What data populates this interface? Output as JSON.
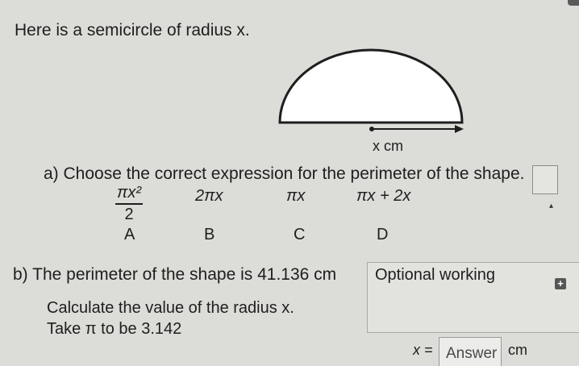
{
  "question": {
    "intro": "Here is a semicircle of radius x.",
    "diagram_label": "x cm"
  },
  "part_a": {
    "prompt": "a) Choose the correct expression for the perimeter of the shape.",
    "options": [
      {
        "numerator": "πx²",
        "denominator": "2",
        "letter": "A"
      },
      {
        "expression": "2πx",
        "letter": "B"
      },
      {
        "expression": "πx",
        "letter": "C"
      },
      {
        "expression": "πx + 2x",
        "letter": "D"
      }
    ]
  },
  "part_b": {
    "statement": "b) The perimeter of the shape is 41.136 cm",
    "instruction": "Calculate the value of the radius x.",
    "pi_note": "Take π to be 3.142",
    "working_label": "Optional working",
    "answer_prefix": "x =",
    "answer_placeholder": "Answer",
    "answer_unit": "cm"
  },
  "icons": [
    "plus-icon",
    "cursor-icon"
  ]
}
